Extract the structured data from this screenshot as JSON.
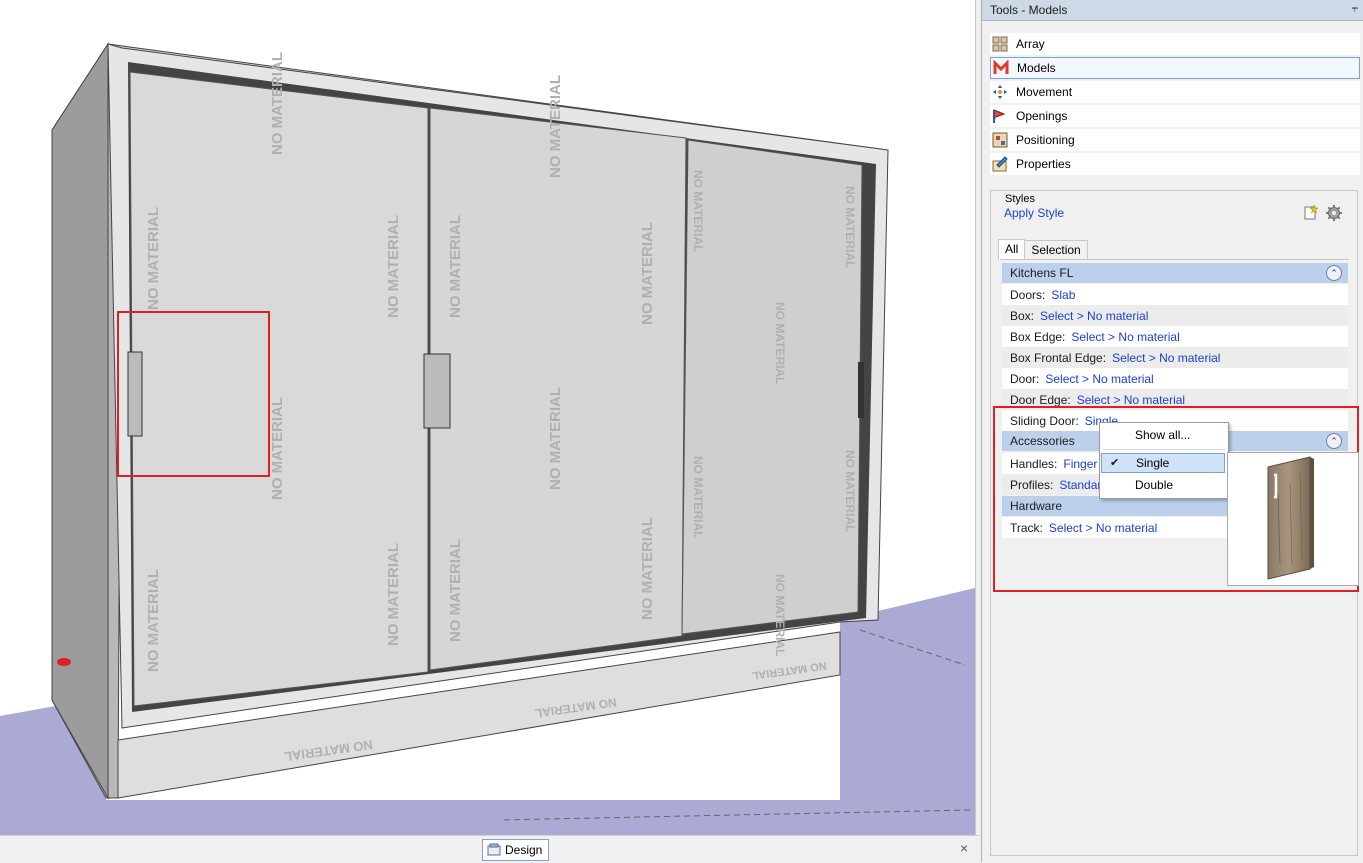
{
  "panel": {
    "title": "Tools - Models",
    "pin": "⫧"
  },
  "tools": [
    {
      "label": "Array",
      "icon": "array-icon"
    },
    {
      "label": "Models",
      "icon": "models-icon",
      "selected": true
    },
    {
      "label": "Movement",
      "icon": "movement-icon"
    },
    {
      "label": "Openings",
      "icon": "openings-icon"
    },
    {
      "label": "Positioning",
      "icon": "positioning-icon"
    },
    {
      "label": "Properties",
      "icon": "properties-icon"
    }
  ],
  "styles": {
    "title": "Styles",
    "apply_link": "Apply Style",
    "tabs": [
      "All",
      "Selection"
    ]
  },
  "groups": {
    "kitchens": {
      "title": "Kitchens FL",
      "rows": [
        {
          "key": "Doors:",
          "value": "Slab"
        },
        {
          "key": "Box:",
          "value": "Select > No material"
        },
        {
          "key": "Box Edge:",
          "value": "Select > No material"
        },
        {
          "key": "Box Frontal Edge:",
          "value": "Select > No material"
        },
        {
          "key": "Door:",
          "value": "Select > No material"
        },
        {
          "key": "Door Edge:",
          "value": "Select > No material"
        },
        {
          "key": "Sliding Door:",
          "value": "Single"
        }
      ]
    },
    "accessories": {
      "title": "Accessories",
      "rows": [
        {
          "key": "Handles:",
          "value": "Finger P"
        },
        {
          "key": "Profiles:",
          "value": "Standard"
        }
      ]
    },
    "hardware": {
      "title": "Hardware",
      "rows": [
        {
          "key": "Track:",
          "value": "Select > No material"
        }
      ]
    }
  },
  "dropdown": {
    "show_all": "Show all...",
    "options": [
      "Single",
      "Double"
    ],
    "selected": "Single",
    "check": "✔"
  },
  "viewport": {
    "watermark": "NO MATERIAL"
  },
  "bottom": {
    "tab_label": "Design",
    "close": "×"
  },
  "colors": {
    "accent_link": "#1c3fd4",
    "group_header": "#bcd0ec",
    "highlight_red": "#e02020",
    "floor": "#aaaad4"
  }
}
